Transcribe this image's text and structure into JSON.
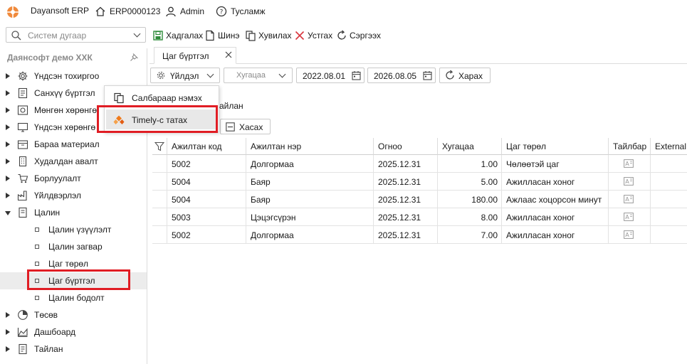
{
  "titlebar": {
    "app_name": "Dayansoft ERP",
    "home_label": "ERP0000123",
    "user_label": "Admin",
    "help_label": "Тусламж"
  },
  "search": {
    "placeholder": "Систем дугаар"
  },
  "toolbar": {
    "save_label": "Хадгалах",
    "new_label": "Шинэ",
    "copy_label": "Хувилах",
    "delete_label": "Устгах",
    "refresh_label": "Сэргээх"
  },
  "sidebar": {
    "company": "Даянсофт демо ХХК",
    "items": [
      {
        "label": "Үндсэн тохиргоо"
      },
      {
        "label": "Санхүү бүртгэл"
      },
      {
        "label": "Мөнгөн хөрөнгө"
      },
      {
        "label": "Үндсэн хөрөнгө"
      },
      {
        "label": "Бараа материал"
      },
      {
        "label": "Худалдан авалт"
      },
      {
        "label": "Борлуулалт"
      },
      {
        "label": "Үйлдвэрлэл"
      },
      {
        "label": "Цалин"
      },
      {
        "label": "Цалин үзүүлэлт"
      },
      {
        "label": "Цалин загвар"
      },
      {
        "label": "Цаг төрөл"
      },
      {
        "label": "Цаг бүртгэл"
      },
      {
        "label": "Цалин бодолт"
      },
      {
        "label": "Төсөв"
      },
      {
        "label": "Дашбоард"
      },
      {
        "label": "Тайлан"
      }
    ]
  },
  "context_menu": {
    "items": [
      {
        "label": "Салбараар нэмэх"
      },
      {
        "label": "Timely-с татах"
      }
    ]
  },
  "tab": {
    "label": "Цаг бүртгэл"
  },
  "filters": {
    "action_label": "Үйлдэл",
    "period_placeholder": "Хугацаа",
    "date_from": "2022.08.01",
    "date_to": "2026.08.05",
    "view_label": "Харах",
    "partial_label": "айлан",
    "remove_label": "Хасах"
  },
  "grid": {
    "columns": [
      "Ажилтан код",
      "Ажилтан нэр",
      "Огноо",
      "Хугацаа",
      "Цаг төрөл",
      "Тайлбар",
      "External"
    ],
    "rows": [
      {
        "code": "5002",
        "name": "Долгормаа",
        "date": "2025.12.31",
        "hours": "1.00",
        "type": "Чөлөөтэй цаг"
      },
      {
        "code": "5004",
        "name": "Баяр",
        "date": "2025.12.31",
        "hours": "5.00",
        "type": "Ажилласан хоног"
      },
      {
        "code": "5004",
        "name": "Баяр",
        "date": "2025.12.31",
        "hours": "180.00",
        "type": "Ажлаас хоцорсон минут"
      },
      {
        "code": "5003",
        "name": "Цэцэгсүрэн",
        "date": "2025.12.31",
        "hours": "8.00",
        "type": "Ажилласан хоног"
      },
      {
        "code": "5002",
        "name": "Долгормаа",
        "date": "2025.12.31",
        "hours": "7.00",
        "type": "Ажилласан хоног"
      }
    ]
  },
  "colors": {
    "highlight_red": "#e01d24",
    "save_green": "#2e8b3a",
    "delete_red": "#d9363e",
    "timely_orange": "#f07a1a"
  }
}
